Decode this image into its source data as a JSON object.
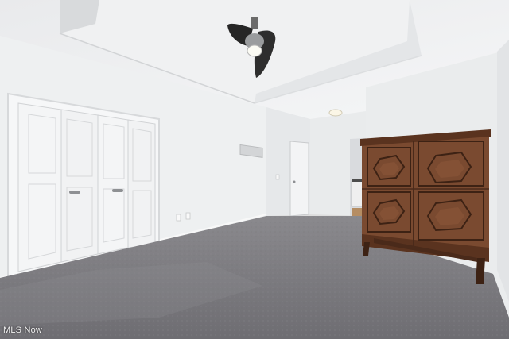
{
  "watermark": {
    "text": "MLS Now"
  },
  "colors": {
    "wall": "#eceeef",
    "ceiling": "#f2f3f4",
    "carpet": "#7a797d",
    "cabinet": "#7a4a30",
    "cabinet_dark": "#4e2c1b",
    "fan": "#2a2a2a"
  }
}
